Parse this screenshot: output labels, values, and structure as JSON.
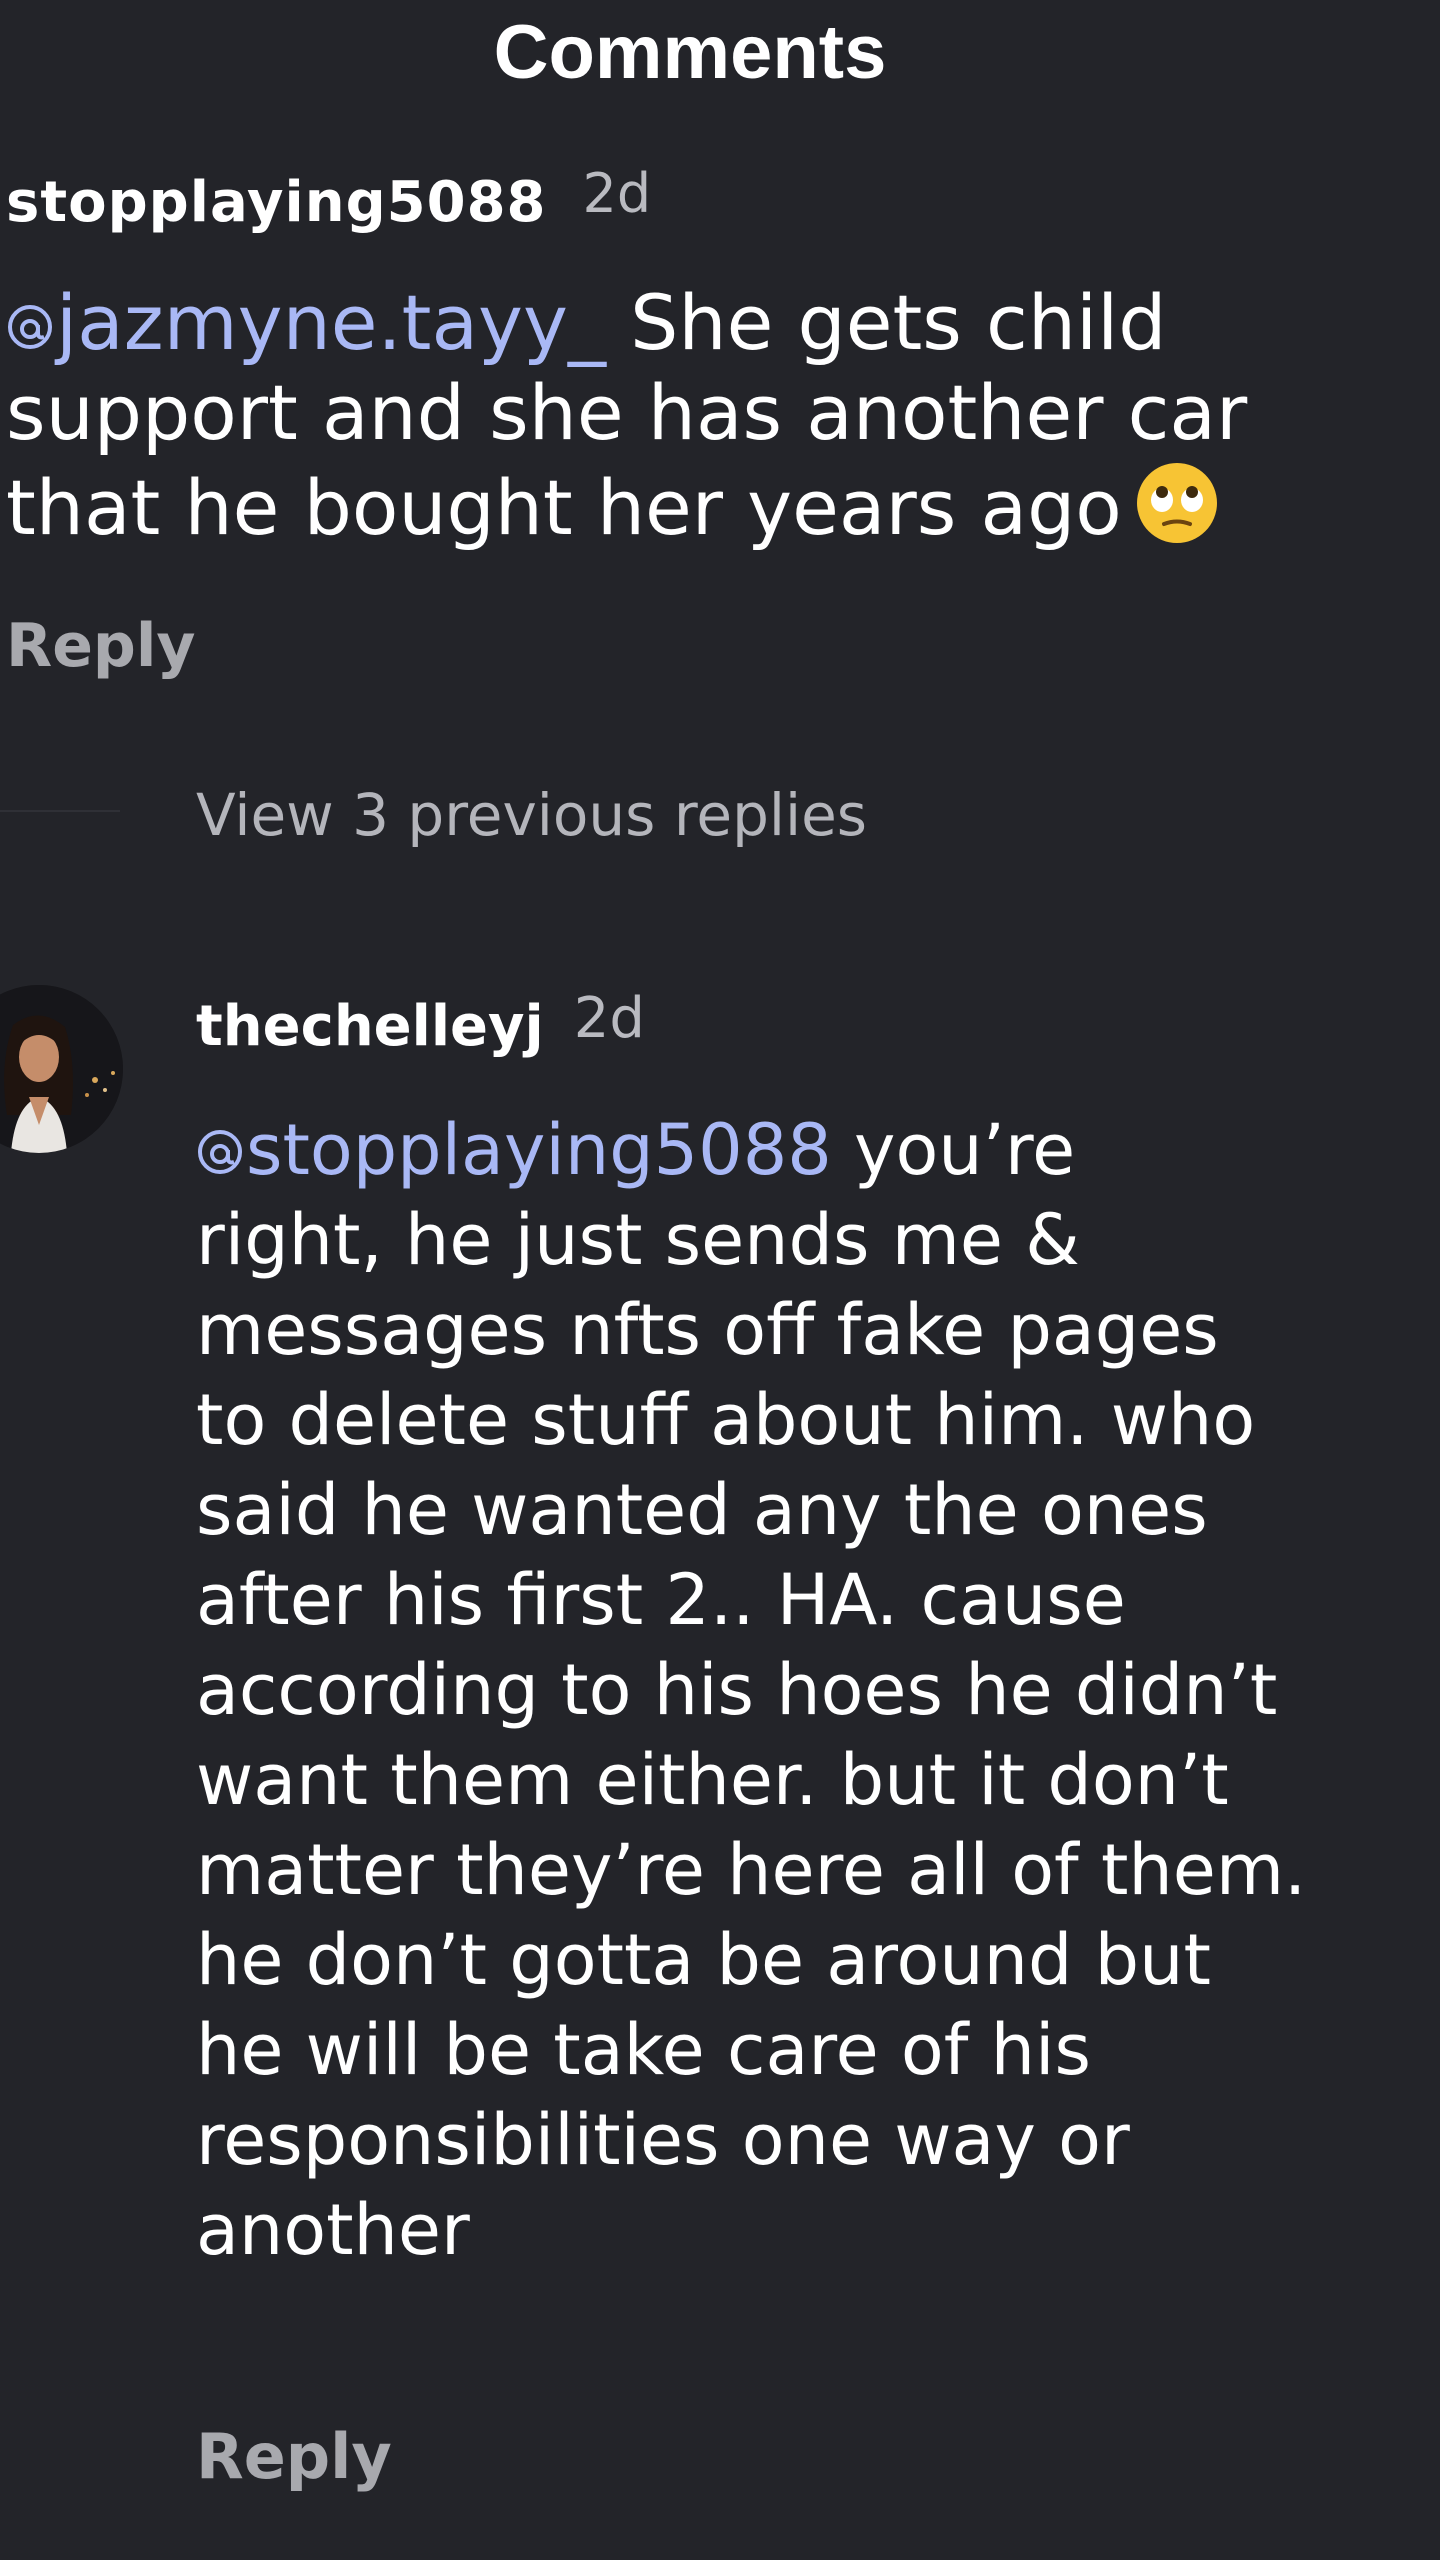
{
  "header": {
    "title": "Comments"
  },
  "comments": [
    {
      "username": "stopplaying5088",
      "time": "2d",
      "mention": "jazmyne.tayy_",
      "text": "She gets child support and she has another car that he bought her years ago",
      "emoji": "face-with-rolling-eyes",
      "reply_label": "Reply"
    },
    {
      "username": "thechelleyj",
      "time": "2d",
      "mention": "stopplaying5088",
      "text_lines": [
        "you’re",
        "right, he just sends me &",
        "messages nfts off fake pages",
        "to delete stuff about him. who",
        "said he wanted any the ones",
        "after his first 2.. HA. cause",
        "according to his hoes he didn’t",
        "want them either. but it don’t",
        "matter they’re here all of them.",
        "he don’t gotta be around but",
        "he will be take care of his",
        "responsibilities one way or",
        "another"
      ],
      "reply_label": "Reply"
    }
  ],
  "thread": {
    "view_replies_label": "View 3 previous replies"
  },
  "colors": {
    "background": "#232429",
    "mention": "#a9b8f5",
    "secondary_text": "#a8a9ae"
  }
}
